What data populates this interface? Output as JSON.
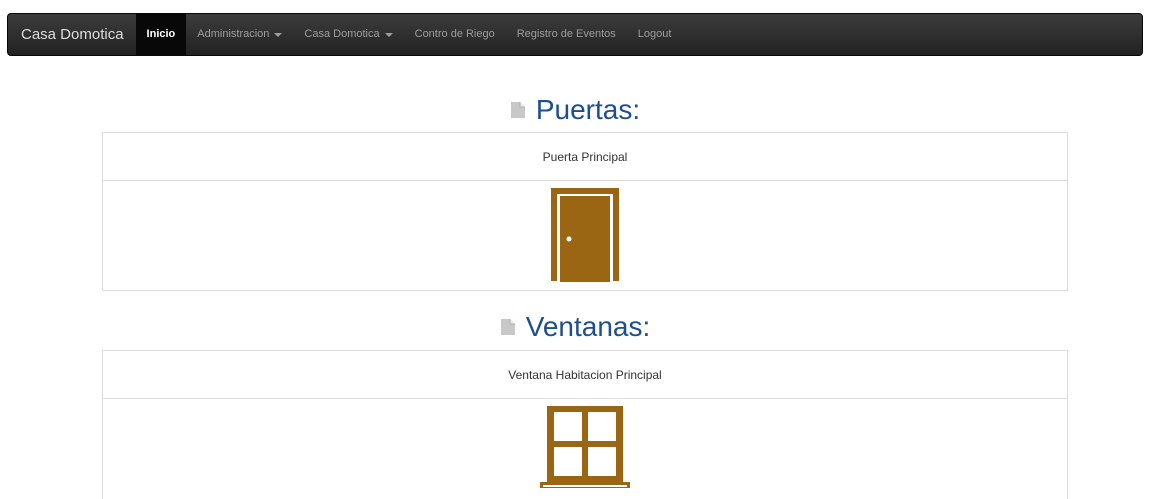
{
  "navbar": {
    "brand": "Casa Domotica",
    "items": [
      {
        "label": "Inicio",
        "active": true,
        "dropdown": false
      },
      {
        "label": "Administracion",
        "active": false,
        "dropdown": true
      },
      {
        "label": "Casa Domotica",
        "active": false,
        "dropdown": true
      },
      {
        "label": "Contro de Riego",
        "active": false,
        "dropdown": false
      },
      {
        "label": "Registro de Eventos",
        "active": false,
        "dropdown": false
      },
      {
        "label": "Logout",
        "active": false,
        "dropdown": false
      }
    ]
  },
  "sections": {
    "doors": {
      "title": "Puertas:",
      "icon": "document-icon",
      "items": [
        {
          "name": "Puerta Principal",
          "icon": "door-icon"
        }
      ]
    },
    "windows": {
      "title": "Ventanas:",
      "icon": "document-icon",
      "items": [
        {
          "name": "Ventana Habitacion Principal",
          "icon": "window-icon"
        }
      ]
    }
  },
  "colors": {
    "navbar_bg": "#222222",
    "title": "#1f4e8c",
    "icon_brown": "#9a6614"
  }
}
